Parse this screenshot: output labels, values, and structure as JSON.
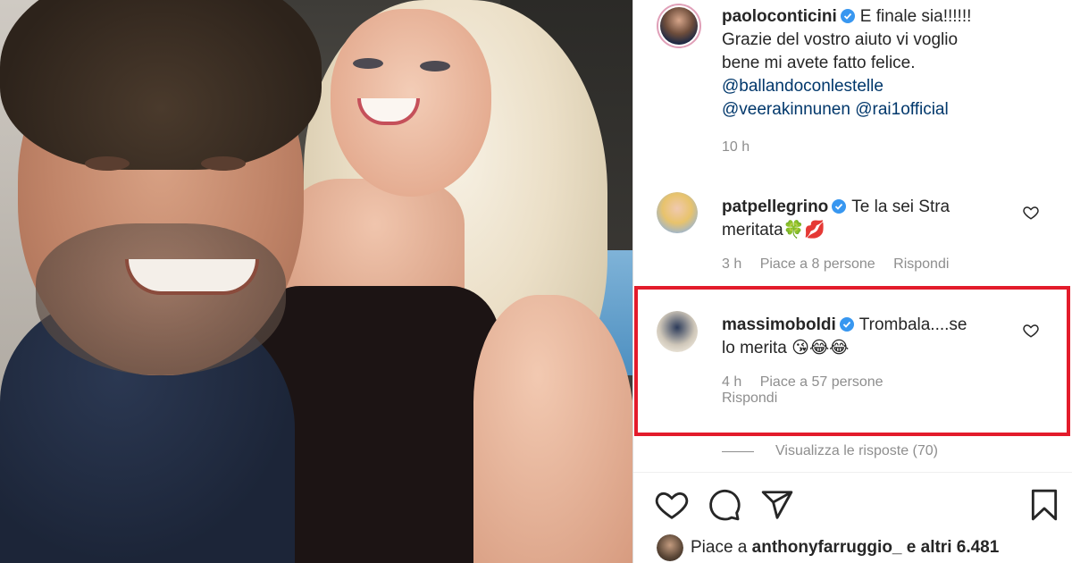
{
  "post": {
    "author": "paolocont­icini",
    "caption_line1": "E finale sia!!!!!!",
    "caption_line2": "Grazie del vostro aiuto vi voglio",
    "caption_line3": "bene mi avete fatto felice.",
    "mention1": "@ballandoconlestelle",
    "mention2": "@veerakinnunen",
    "mention3": "@rai1official",
    "time": "10 h"
  },
  "comments": [
    {
      "author": "patpellegrino",
      "text_line1": "Te la sei Stra",
      "text_line2": "meritata🍀💋",
      "time": "3 h",
      "likes": "Piace a 8 persone",
      "reply": "Rispondi"
    },
    {
      "author": "massimoboldi",
      "text_line1": "Trombala....se",
      "text_line2": "lo merita 😘😂😂",
      "time": "4 h",
      "likes": "Piace a 57 persone",
      "reply": "Rispondi"
    }
  ],
  "view_replies": "Visualizza le risposte (70)",
  "liked_by": {
    "prefix": "Piace a",
    "user": "anthonyfarruggio_",
    "suffix": "e altri 6.481"
  },
  "colors": {
    "highlight": "#e31b2b",
    "verified": "#3897f0",
    "mention": "#00376b",
    "meta": "#8e8e8e"
  },
  "icons": [
    "verified-badge-icon",
    "heart-icon",
    "comment-icon",
    "share-icon",
    "bookmark-icon"
  ]
}
